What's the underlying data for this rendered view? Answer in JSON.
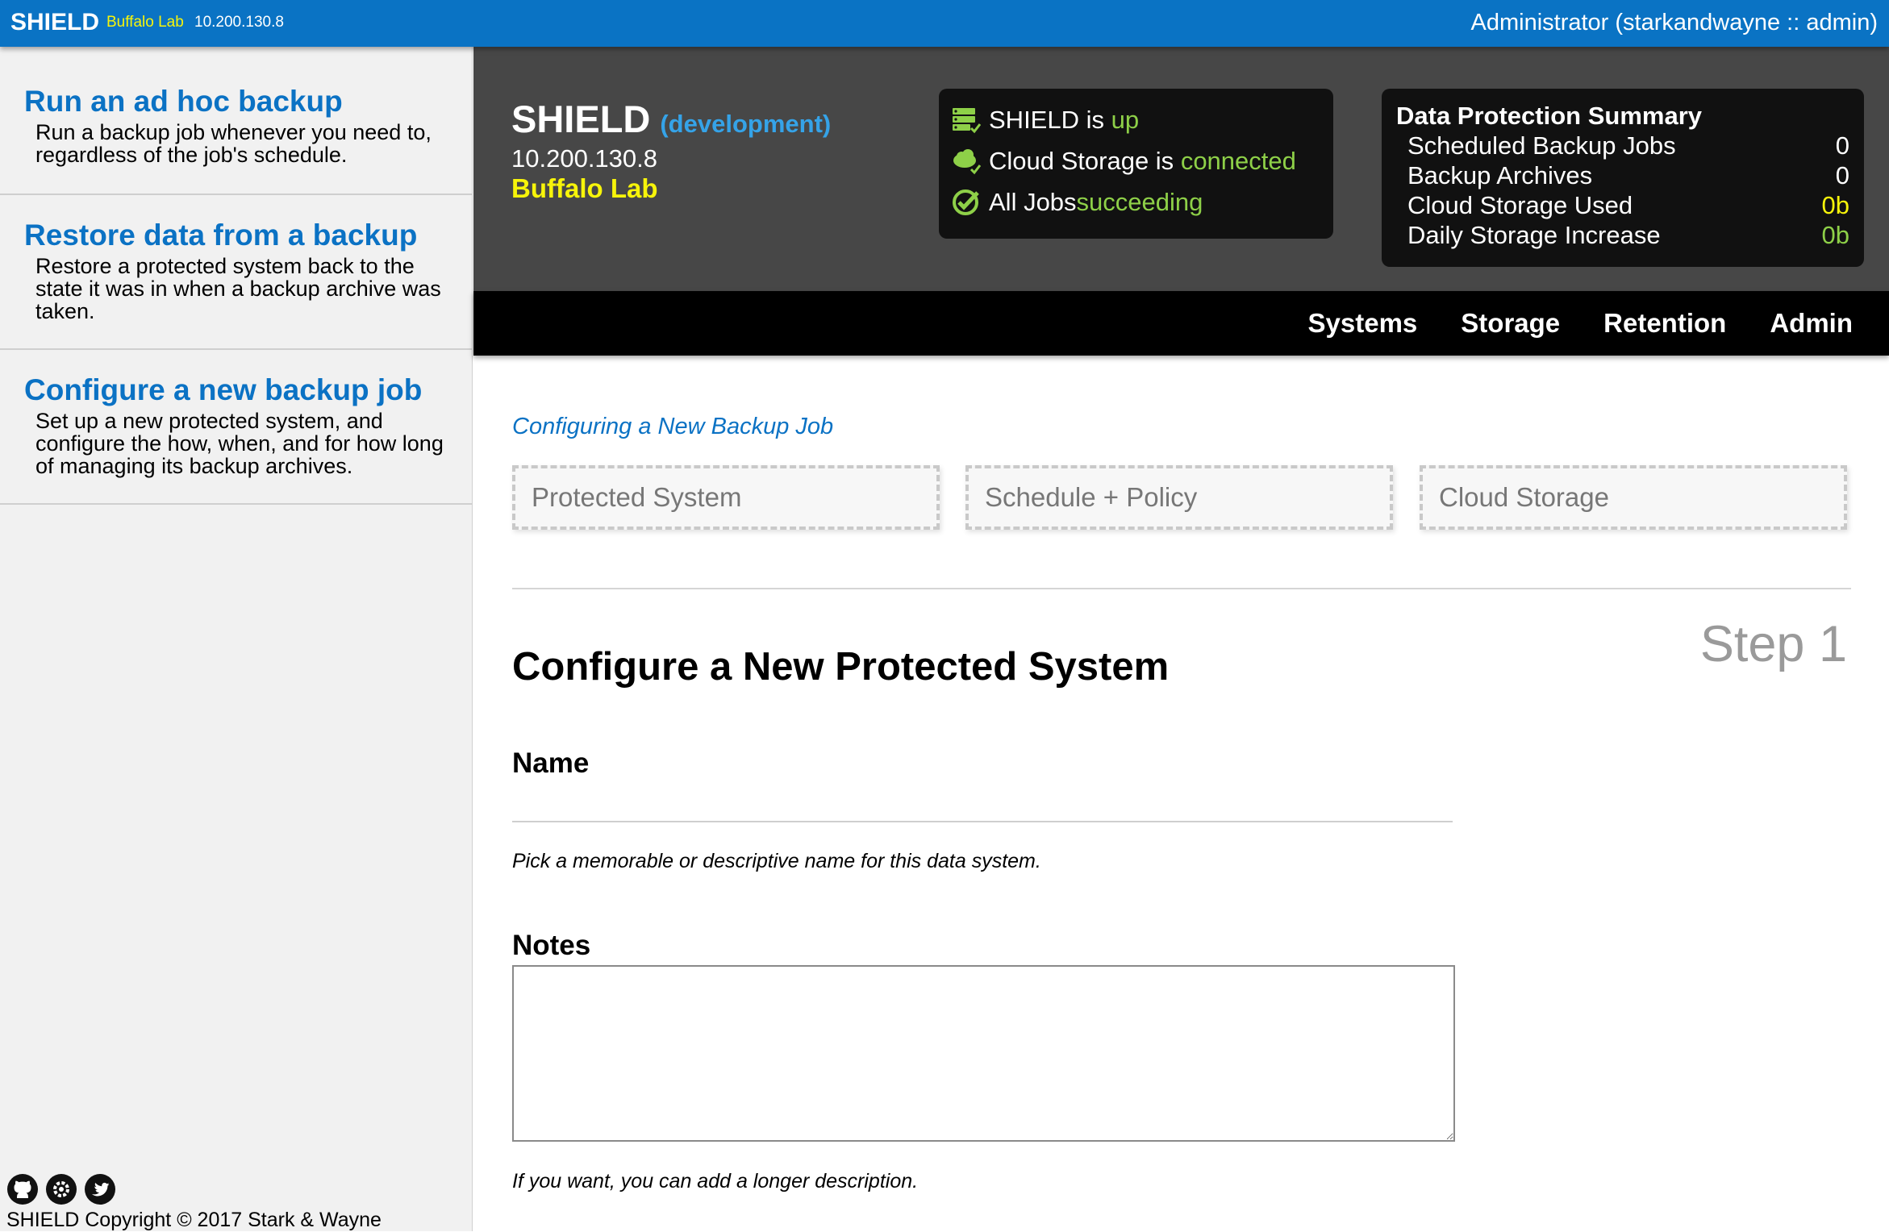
{
  "topbar": {
    "brand": "SHIELD",
    "env_name": "Buffalo Lab",
    "ip": "10.200.130.8",
    "user": "Administrator (starkandwayne :: admin)"
  },
  "sidebar": {
    "items": [
      {
        "title": "Run an ad hoc backup",
        "description": "Run a backup job whenever you need to, regardless of the job's schedule."
      },
      {
        "title": "Restore data from a backup",
        "description": "Restore a protected system back to the state it was in when a backup archive was taken."
      },
      {
        "title": "Configure a new backup job",
        "description": "Set up a new protected system, and configure the how, when, and for how long of managing its backup archives."
      }
    ],
    "footer": {
      "icons": [
        "github-icon",
        "gear-icon",
        "twitter-icon"
      ],
      "copyright": "SHIELD Copyright © 2017 Stark & Wayne"
    }
  },
  "status": {
    "system_name": "SHIELD",
    "system_env": "(development)",
    "ip": "10.200.130.8",
    "lab": "Buffalo Lab",
    "health": [
      {
        "icon": "server-check-icon",
        "prefix": "SHIELD is ",
        "status": "up"
      },
      {
        "icon": "cloud-check-icon",
        "prefix": "Cloud Storage is ",
        "status": "connected"
      },
      {
        "icon": "checkmark-badge-icon",
        "prefix": "All Jobs ",
        "status": "succeeding"
      }
    ],
    "summary": {
      "heading": "Data Protection Summary",
      "rows": [
        {
          "label": "Scheduled Backup Jobs",
          "value": "0"
        },
        {
          "label": "Backup Archives",
          "value": "0"
        },
        {
          "label": "Cloud Storage Used",
          "value": "0b"
        },
        {
          "label": "Daily Storage Increase",
          "value": "0b"
        }
      ]
    }
  },
  "nav": {
    "items": [
      "Systems",
      "Storage",
      "Retention",
      "Admin"
    ]
  },
  "main": {
    "breadcrumb": "Configuring a New Backup Job",
    "steps": [
      "Protected System",
      "Schedule + Policy",
      "Cloud Storage"
    ],
    "step_indicator": "Step 1",
    "form_title": "Configure a New Protected System",
    "name_label": "Name",
    "name_value": "",
    "name_help": "Pick a memorable or descriptive name for this data system.",
    "notes_label": "Notes",
    "notes_value": "",
    "notes_help": "If you want, you can add a longer description."
  },
  "colors": {
    "topbar": "#0a73c4",
    "accent_blue": "#0b72c4",
    "status_ok": "#8ed048",
    "lab_yellow": "#f7f40a",
    "header_bg": "#474747",
    "panel_bg": "#111111"
  }
}
